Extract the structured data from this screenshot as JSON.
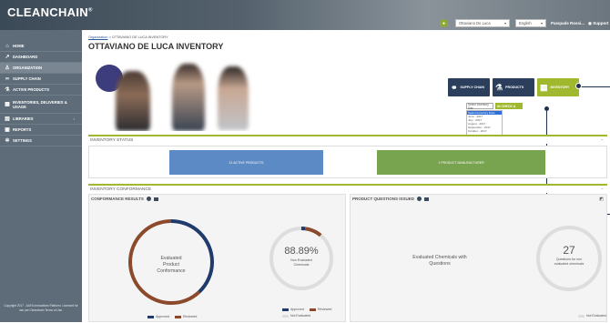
{
  "header": {
    "logo": "CLEANCHAIN",
    "logo_mark": "®",
    "supplier_select": "Ottaviano De Luca",
    "language_select": "English",
    "user": "Pasquale Rossi...",
    "support": "Support"
  },
  "sidebar": {
    "collapse_icon": "‹",
    "items": [
      {
        "label": "HOME",
        "icon": "home-icon"
      },
      {
        "label": "DASHBOARD",
        "icon": "chart-icon"
      },
      {
        "label": "ORGANIZATION",
        "icon": "org-icon"
      },
      {
        "label": "SUPPLY CHAIN",
        "icon": "link-icon"
      },
      {
        "label": "ACTIVE PRODUCTS",
        "icon": "flask-icon"
      },
      {
        "label": "INVENTORIES, DELIVERIES & USAGE",
        "icon": "table-icon"
      },
      {
        "label": "LIBRARIES",
        "icon": "book-icon"
      },
      {
        "label": "REPORTS",
        "icon": "report-icon"
      },
      {
        "label": "SETTINGS",
        "icon": "gear-icon"
      }
    ],
    "copyright": "Copyright 2017 - AAFA Innovations Platform. Licensed for use per Cleanchain Terms of Use."
  },
  "breadcrumb": {
    "link": "Organization",
    "sep": ">",
    "current": "OTTAVIANO DE LUCA INVENTORY"
  },
  "page_title": "OTTAVIANO DE LUCA INVENTORY",
  "hero_buttons": {
    "supply_chain": "SUPPLY CHAIN",
    "products": "PRODUCTS",
    "inventory": "INVENTORY"
  },
  "inventory_select": {
    "placeholder": "Select Inventory Da▾",
    "checkin_label": "IN CHECK A",
    "options": [
      "Select Inventory Date",
      "June - 2017",
      "July - 2017",
      "August - 2017",
      "September - 2017",
      "October - 2017",
      "November - 2017"
    ]
  },
  "inventory_status": {
    "title": "INVENTORY STATUS",
    "active_products": "21 ACTIVE PRODUCTS",
    "manufacturer": "1 PRODUCT MANUFACTURER"
  },
  "inventory_conformance": {
    "title": "INVENTORY CONFORMANCE"
  },
  "conformance_results": {
    "title": "CONFORMANCE RESULTS",
    "center_label": "Evaluated Product Conformance",
    "legend_approved": "Approved",
    "legend_reviewed": "Reviewed"
  },
  "chemicals": {
    "percent": "88.89%",
    "label": "Non Evaluated Chemicals",
    "legend_approved": "Approved",
    "legend_reviewed": "Reviewed",
    "legend_not_evaluated": "Not Evaluated"
  },
  "questions": {
    "title": "PRODUCT QUESTIONS ISSUED",
    "center_label": "Evaluated Chemicals with Questions",
    "count": "27",
    "count_label": "Questions for non evaluated chemicals",
    "legend_not_evaluated": "Not Evaluated"
  },
  "chart_data": [
    {
      "type": "pie",
      "title": "CONFORMANCE RESULTS",
      "labels": [
        "Approved",
        "Reviewed"
      ],
      "values": [
        38,
        62
      ],
      "colors": [
        "#1f3a6b",
        "#8b4a2b"
      ]
    },
    {
      "type": "pie",
      "labels": [
        "Approved",
        "Reviewed",
        "Not Evaluated"
      ],
      "values": [
        2,
        9.11,
        88.89
      ],
      "colors": [
        "#1f3a6b",
        "#8b4a2b",
        "#dddddd"
      ]
    },
    {
      "type": "pie",
      "title": "PRODUCT QUESTIONS ISSUED",
      "labels": [
        "Not Evaluated"
      ],
      "values": [
        100
      ],
      "colors": [
        "#dddddd"
      ]
    }
  ],
  "colors": {
    "accent": "#9fb82e",
    "navy": "#2b3f5c",
    "blue_bar": "#5b8ac4",
    "green_bar": "#79a44f"
  }
}
